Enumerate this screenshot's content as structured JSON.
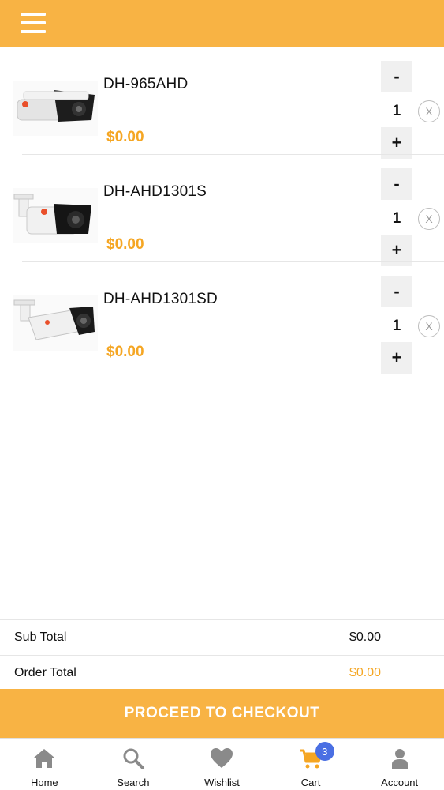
{
  "header": {
    "menu_icon": "hamburger-menu-icon"
  },
  "cart": {
    "items": [
      {
        "name": "DH-965AHD",
        "price": "$0.00",
        "quantity": "1",
        "minus_label": "-",
        "plus_label": "+",
        "remove_label": "X",
        "image": "bullet-camera-black-visor"
      },
      {
        "name": "DH-AHD1301S",
        "price": "$0.00",
        "quantity": "1",
        "minus_label": "-",
        "plus_label": "+",
        "remove_label": "X",
        "image": "bullet-camera-white-bracket"
      },
      {
        "name": "DH-AHD1301SD",
        "price": "$0.00",
        "quantity": "1",
        "minus_label": "-",
        "plus_label": "+",
        "remove_label": "X",
        "image": "bullet-camera-white-bracket-black-lens"
      }
    ]
  },
  "totals": {
    "sub_total_label": "Sub Total",
    "sub_total_value": "$0.00",
    "order_total_label": "Order Total",
    "order_total_value": "$0.00"
  },
  "checkout": {
    "label": "PROCEED TO CHECKOUT"
  },
  "tabbar": {
    "tabs": [
      {
        "label": "Home",
        "icon": "home-icon"
      },
      {
        "label": "Search",
        "icon": "search-icon"
      },
      {
        "label": "Wishlist",
        "icon": "heart-icon"
      },
      {
        "label": "Cart",
        "icon": "cart-icon",
        "badge": "3"
      },
      {
        "label": "Account",
        "icon": "user-icon"
      }
    ]
  },
  "colors": {
    "accent": "#f8b344",
    "price": "#f5a623",
    "badge": "#4a6fe3",
    "tab_icon": "#8a8a8a"
  }
}
